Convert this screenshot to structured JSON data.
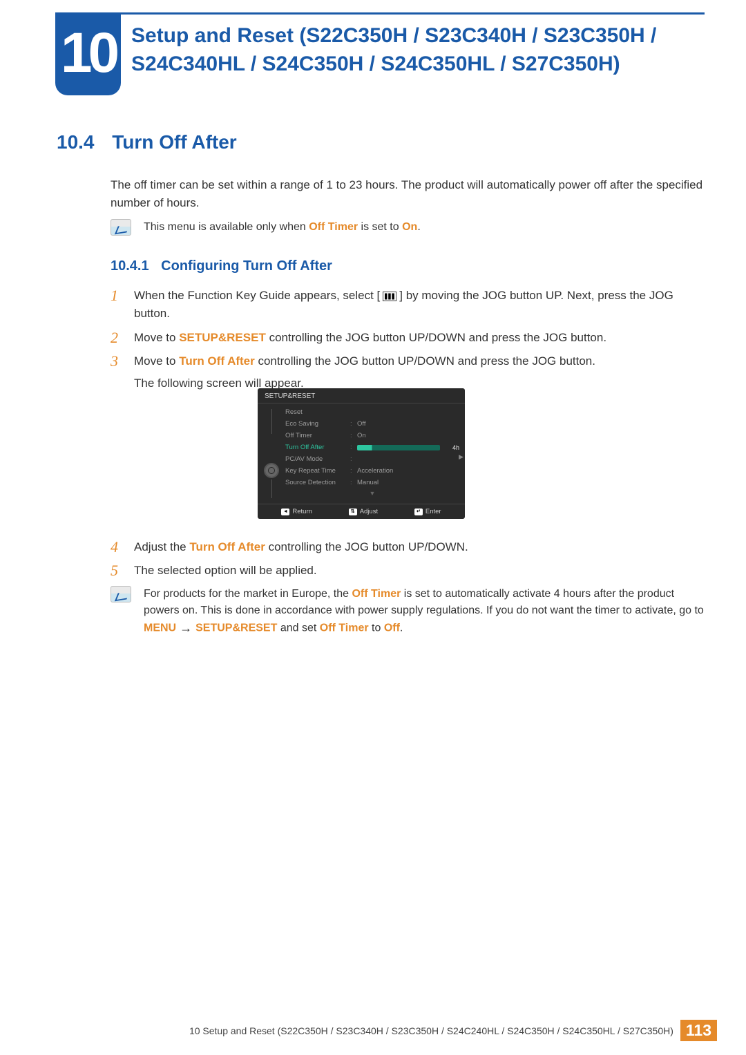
{
  "chapter": {
    "number": "10",
    "title": "Setup and Reset (S22C350H / S23C340H / S23C350H / S24C340HL / S24C350H / S24C350HL / S27C350H)"
  },
  "section": {
    "number": "10.4",
    "title": "Turn Off After",
    "intro": "The off timer can be set within a range of 1 to 23 hours. The product will automatically power off after the specified number of hours."
  },
  "note1": {
    "pre": "This menu is available only when ",
    "hl1": "Off Timer",
    "mid": " is set to ",
    "hl2": "On",
    "post": "."
  },
  "subsection": {
    "number": "10.4.1",
    "title": "Configuring Turn Off After"
  },
  "steps": {
    "s1": {
      "n": "1",
      "pre": "When the Function Key Guide appears, select [",
      "post": "] by moving the JOG button UP. Next, press the JOG button."
    },
    "s2": {
      "n": "2",
      "pre": "Move to ",
      "hl": "SETUP&RESET",
      "post": " controlling the JOG button UP/DOWN and press the JOG button."
    },
    "s3": {
      "n": "3",
      "pre": "Move to ",
      "hl": "Turn Off After",
      "post": " controlling the JOG button UP/DOWN and press the JOG button.",
      "extra": "The following screen will appear."
    },
    "s4": {
      "n": "4",
      "pre": "Adjust the ",
      "hl": "Turn Off After",
      "post": " controlling the JOG button UP/DOWN."
    },
    "s5": {
      "n": "5",
      "text": "The selected option will be applied."
    }
  },
  "osd": {
    "title": "SETUP&RESET",
    "rows": {
      "reset": {
        "label": "Reset",
        "val": ""
      },
      "eco": {
        "label": "Eco Saving",
        "val": "Off"
      },
      "timer": {
        "label": "Off Timer",
        "val": "On"
      },
      "toa": {
        "label": "Turn Off After",
        "val": "4h"
      },
      "pcav": {
        "label": "PC/AV Mode",
        "val": ""
      },
      "krt": {
        "label": "Key Repeat Time",
        "val": "Acceleration"
      },
      "src": {
        "label": "Source Detection",
        "val": "Manual"
      }
    },
    "footer": {
      "return": "Return",
      "adjust": "Adjust",
      "enter": "Enter"
    }
  },
  "note2": {
    "pre": "For products for the market in Europe, the ",
    "hl1": "Off Timer",
    "mid1": " is set to automatically activate 4 hours after the product powers on. This is done in accordance with power supply regulations. If you do not want the timer to activate, go to ",
    "hl2": "MENU",
    "arrow": " → ",
    "hl3": "SETUP&RESET",
    "mid2": " and set ",
    "hl4": "Off Timer",
    "mid3": " to ",
    "hl5": "Off",
    "post": "."
  },
  "footer": {
    "text": "10 Setup and Reset (S22C350H / S23C340H / S23C350H / S24C240HL / S24C350H / S24C350HL / S27C350H)",
    "page": "113"
  }
}
